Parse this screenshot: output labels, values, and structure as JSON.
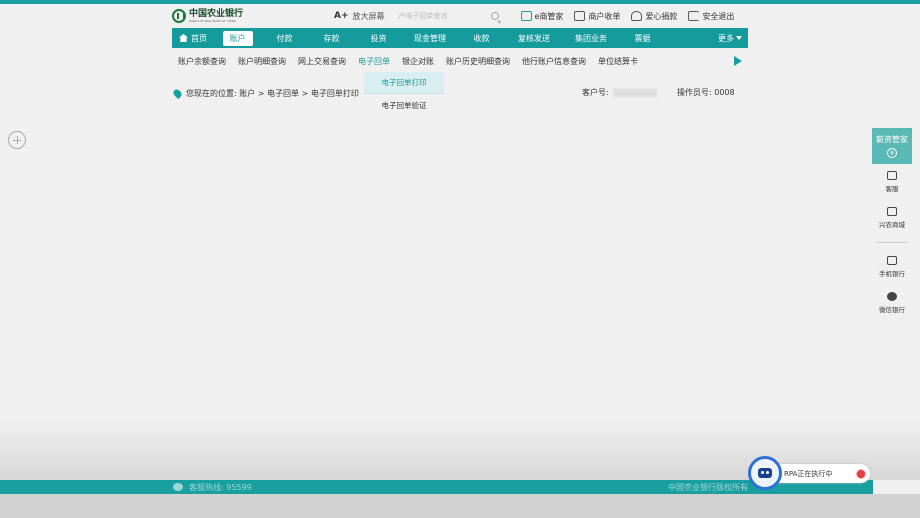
{
  "header": {
    "logo_cn": "中国农业银行",
    "logo_en": "AGRICULTURAL BANK OF CHINA",
    "zoom_prefix": "A+",
    "zoom_label": "放大屏幕",
    "search_placeholder": "户电子回单查询",
    "links": [
      "e商管家",
      "商户收单",
      "爱心捐款",
      "安全退出"
    ]
  },
  "nav": {
    "home": "首页",
    "items": [
      "账户",
      "付款",
      "存款",
      "投资",
      "现金管理",
      "收款",
      "复核发送",
      "集团业务",
      "票据"
    ],
    "active": "账户",
    "more": "更多"
  },
  "subnav": {
    "items": [
      "账户余额查询",
      "账户明细查询",
      "网上交易查询",
      "电子回单",
      "银企对账",
      "账户历史明细查询",
      "他行账户信息查询",
      "单位结算卡"
    ],
    "active": "电子回单"
  },
  "dropdown": {
    "items": [
      "电子回单打印",
      "电子回单验证"
    ],
    "selected": "电子回单打印"
  },
  "breadcrumb": {
    "text": "您现在的位置: 账户 > 电子回单 > 电子回单打印"
  },
  "customer": {
    "label": "客户号:",
    "operator": "操作员号: 0008"
  },
  "sidepanel": {
    "top": "薪资管家",
    "coin": "¥",
    "items": [
      "客服",
      "兴农商城",
      "手机银行",
      "微信银行"
    ]
  },
  "footer": {
    "hotline": "客服热线: 95599",
    "copyright": "中国农业银行版权所有"
  },
  "rpa": {
    "status": "RPA正在执行中"
  },
  "colors": {
    "primary": "#169b9c",
    "side_top": "#5ab8b5",
    "rpa_ring": "#2f6fd6",
    "stop": "#e04040"
  }
}
